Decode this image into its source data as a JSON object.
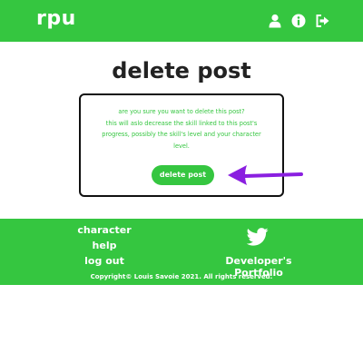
{
  "header": {
    "logo": "rpu",
    "icons": [
      "user-icon",
      "info-icon",
      "sign-out-icon"
    ],
    "background": "#35c640"
  },
  "page": {
    "title": "delete post"
  },
  "dialog": {
    "message_lines": [
      "are you sure you want to delete this post?",
      "this will aslo decrease the skill linked to this post's",
      "progress, possibly the skill's level and your character",
      "level."
    ],
    "delete_label": "delete post"
  },
  "annotation": {
    "arrow_color": "#8a1fe0",
    "arrow_direction": "left"
  },
  "footer": {
    "links": [
      "character",
      "help",
      "log out"
    ],
    "social_icon": "twitter-icon",
    "portfolio_label": "Developer's Portfolio",
    "copyright": "Copyright© Louis Savoie 2021. All rights reserved."
  }
}
